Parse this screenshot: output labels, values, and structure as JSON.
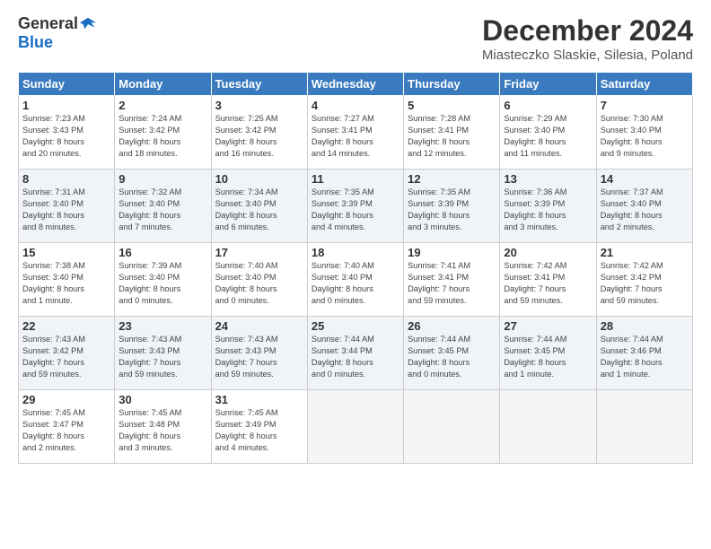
{
  "logo": {
    "general": "General",
    "blue": "Blue"
  },
  "title": "December 2024",
  "subtitle": "Miasteczko Slaskie, Silesia, Poland",
  "calendar": {
    "headers": [
      "Sunday",
      "Monday",
      "Tuesday",
      "Wednesday",
      "Thursday",
      "Friday",
      "Saturday"
    ],
    "rows": [
      [
        {
          "day": "1",
          "info": "Sunrise: 7:23 AM\nSunset: 3:43 PM\nDaylight: 8 hours\nand 20 minutes."
        },
        {
          "day": "2",
          "info": "Sunrise: 7:24 AM\nSunset: 3:42 PM\nDaylight: 8 hours\nand 18 minutes."
        },
        {
          "day": "3",
          "info": "Sunrise: 7:25 AM\nSunset: 3:42 PM\nDaylight: 8 hours\nand 16 minutes."
        },
        {
          "day": "4",
          "info": "Sunrise: 7:27 AM\nSunset: 3:41 PM\nDaylight: 8 hours\nand 14 minutes."
        },
        {
          "day": "5",
          "info": "Sunrise: 7:28 AM\nSunset: 3:41 PM\nDaylight: 8 hours\nand 12 minutes."
        },
        {
          "day": "6",
          "info": "Sunrise: 7:29 AM\nSunset: 3:40 PM\nDaylight: 8 hours\nand 11 minutes."
        },
        {
          "day": "7",
          "info": "Sunrise: 7:30 AM\nSunset: 3:40 PM\nDaylight: 8 hours\nand 9 minutes."
        }
      ],
      [
        {
          "day": "8",
          "info": "Sunrise: 7:31 AM\nSunset: 3:40 PM\nDaylight: 8 hours\nand 8 minutes."
        },
        {
          "day": "9",
          "info": "Sunrise: 7:32 AM\nSunset: 3:40 PM\nDaylight: 8 hours\nand 7 minutes."
        },
        {
          "day": "10",
          "info": "Sunrise: 7:34 AM\nSunset: 3:40 PM\nDaylight: 8 hours\nand 6 minutes."
        },
        {
          "day": "11",
          "info": "Sunrise: 7:35 AM\nSunset: 3:39 PM\nDaylight: 8 hours\nand 4 minutes."
        },
        {
          "day": "12",
          "info": "Sunrise: 7:35 AM\nSunset: 3:39 PM\nDaylight: 8 hours\nand 3 minutes."
        },
        {
          "day": "13",
          "info": "Sunrise: 7:36 AM\nSunset: 3:39 PM\nDaylight: 8 hours\nand 3 minutes."
        },
        {
          "day": "14",
          "info": "Sunrise: 7:37 AM\nSunset: 3:40 PM\nDaylight: 8 hours\nand 2 minutes."
        }
      ],
      [
        {
          "day": "15",
          "info": "Sunrise: 7:38 AM\nSunset: 3:40 PM\nDaylight: 8 hours\nand 1 minute."
        },
        {
          "day": "16",
          "info": "Sunrise: 7:39 AM\nSunset: 3:40 PM\nDaylight: 8 hours\nand 0 minutes."
        },
        {
          "day": "17",
          "info": "Sunrise: 7:40 AM\nSunset: 3:40 PM\nDaylight: 8 hours\nand 0 minutes."
        },
        {
          "day": "18",
          "info": "Sunrise: 7:40 AM\nSunset: 3:40 PM\nDaylight: 8 hours\nand 0 minutes."
        },
        {
          "day": "19",
          "info": "Sunrise: 7:41 AM\nSunset: 3:41 PM\nDaylight: 7 hours\nand 59 minutes."
        },
        {
          "day": "20",
          "info": "Sunrise: 7:42 AM\nSunset: 3:41 PM\nDaylight: 7 hours\nand 59 minutes."
        },
        {
          "day": "21",
          "info": "Sunrise: 7:42 AM\nSunset: 3:42 PM\nDaylight: 7 hours\nand 59 minutes."
        }
      ],
      [
        {
          "day": "22",
          "info": "Sunrise: 7:43 AM\nSunset: 3:42 PM\nDaylight: 7 hours\nand 59 minutes."
        },
        {
          "day": "23",
          "info": "Sunrise: 7:43 AM\nSunset: 3:43 PM\nDaylight: 7 hours\nand 59 minutes."
        },
        {
          "day": "24",
          "info": "Sunrise: 7:43 AM\nSunset: 3:43 PM\nDaylight: 7 hours\nand 59 minutes."
        },
        {
          "day": "25",
          "info": "Sunrise: 7:44 AM\nSunset: 3:44 PM\nDaylight: 8 hours\nand 0 minutes."
        },
        {
          "day": "26",
          "info": "Sunrise: 7:44 AM\nSunset: 3:45 PM\nDaylight: 8 hours\nand 0 minutes."
        },
        {
          "day": "27",
          "info": "Sunrise: 7:44 AM\nSunset: 3:45 PM\nDaylight: 8 hours\nand 1 minute."
        },
        {
          "day": "28",
          "info": "Sunrise: 7:44 AM\nSunset: 3:46 PM\nDaylight: 8 hours\nand 1 minute."
        }
      ],
      [
        {
          "day": "29",
          "info": "Sunrise: 7:45 AM\nSunset: 3:47 PM\nDaylight: 8 hours\nand 2 minutes."
        },
        {
          "day": "30",
          "info": "Sunrise: 7:45 AM\nSunset: 3:48 PM\nDaylight: 8 hours\nand 3 minutes."
        },
        {
          "day": "31",
          "info": "Sunrise: 7:45 AM\nSunset: 3:49 PM\nDaylight: 8 hours\nand 4 minutes."
        },
        {
          "day": "",
          "info": ""
        },
        {
          "day": "",
          "info": ""
        },
        {
          "day": "",
          "info": ""
        },
        {
          "day": "",
          "info": ""
        }
      ]
    ]
  }
}
